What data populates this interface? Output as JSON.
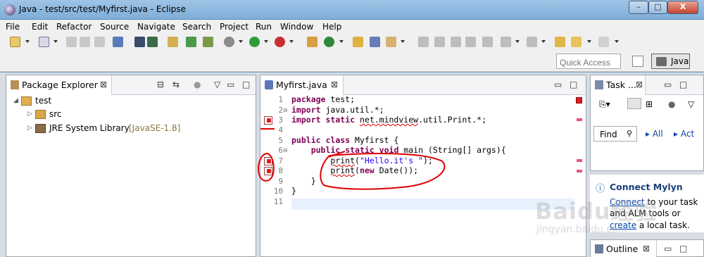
{
  "window": {
    "title": "Java - test/src/test/Myfirst.java - Eclipse",
    "min_label": "–",
    "max_label": "□",
    "close_label": "X"
  },
  "menu": [
    "File",
    "Edit",
    "Refactor",
    "Source",
    "Navigate",
    "Search",
    "Project",
    "Run",
    "Window",
    "Help"
  ],
  "quick_access": {
    "placeholder": "Quick Access"
  },
  "perspective": {
    "java_label": "Java"
  },
  "package_explorer": {
    "tab_label": "Package Explorer",
    "items": [
      {
        "label": "test",
        "depth": 0,
        "expanded": true
      },
      {
        "label": "src",
        "depth": 1,
        "expanded": false
      },
      {
        "label": "JRE System Library",
        "suffix": "[JavaSE-1.8]",
        "depth": 1,
        "expanded": false
      }
    ]
  },
  "editor": {
    "tab_label": "Myfirst.java",
    "line_numbers": [
      "1",
      "2",
      "3",
      "4",
      "5",
      "6",
      "7",
      "8",
      "9",
      "10",
      "11"
    ],
    "errors_on_lines": [
      3,
      7,
      8
    ]
  },
  "task_list": {
    "tab_label": "Task ...",
    "find_placeholder": "Find",
    "all_label": "All",
    "act_label": "Act"
  },
  "mylyn": {
    "heading": "Connect Mylyn",
    "connect_link": "Connect",
    "line1_rest": " to your task",
    "line2": "and ALM tools or",
    "create_link": "create",
    "line3_rest": " a local task."
  },
  "outline": {
    "tab_label": "Outline"
  },
  "watermark": {
    "text": "Baidu经验",
    "sub": "jingyan.baidu.com"
  },
  "colors": {
    "keyword": "#7f0055",
    "string": "#2a00ff",
    "error": "#d82020",
    "annotation": "#e00000",
    "link": "#0645ad"
  }
}
